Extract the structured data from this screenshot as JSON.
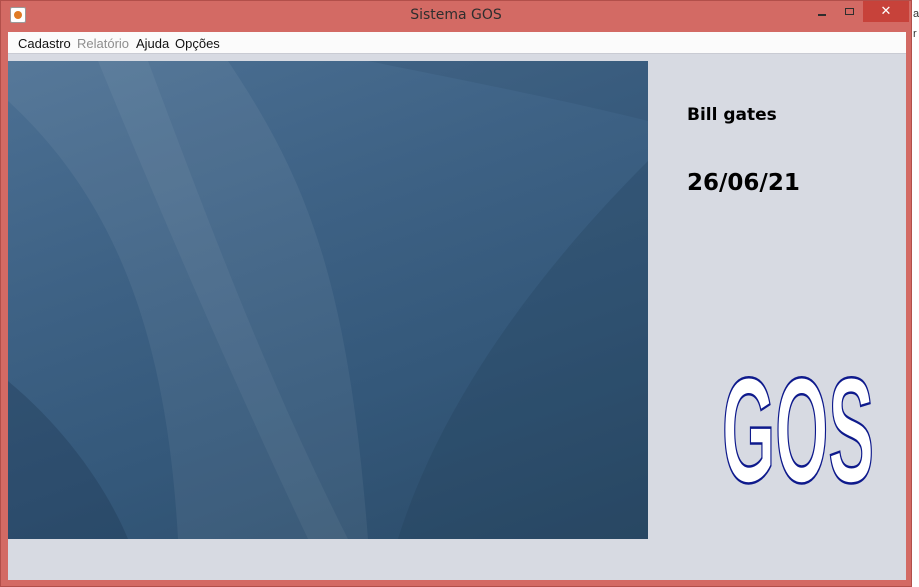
{
  "window": {
    "title": "Sistema GOS",
    "close_glyph": "✕"
  },
  "menu": [
    {
      "label": "Cadastro",
      "enabled": true
    },
    {
      "label": "Relatório",
      "enabled": false
    },
    {
      "label": "Ajuda",
      "enabled": true
    },
    {
      "label": "Opções",
      "enabled": true
    }
  ],
  "main": {
    "user_name": "Bill gates",
    "date": "26/06/21",
    "logo_text": "GOS"
  },
  "colors": {
    "titlebar": "#d36a64",
    "close_button": "#c7423a",
    "content_bg": "#d7dae2",
    "logo_stroke": "#0e1a8c",
    "wallpaper_base": "#3e6285"
  },
  "background_window": {
    "letters": [
      "a",
      "r"
    ]
  }
}
